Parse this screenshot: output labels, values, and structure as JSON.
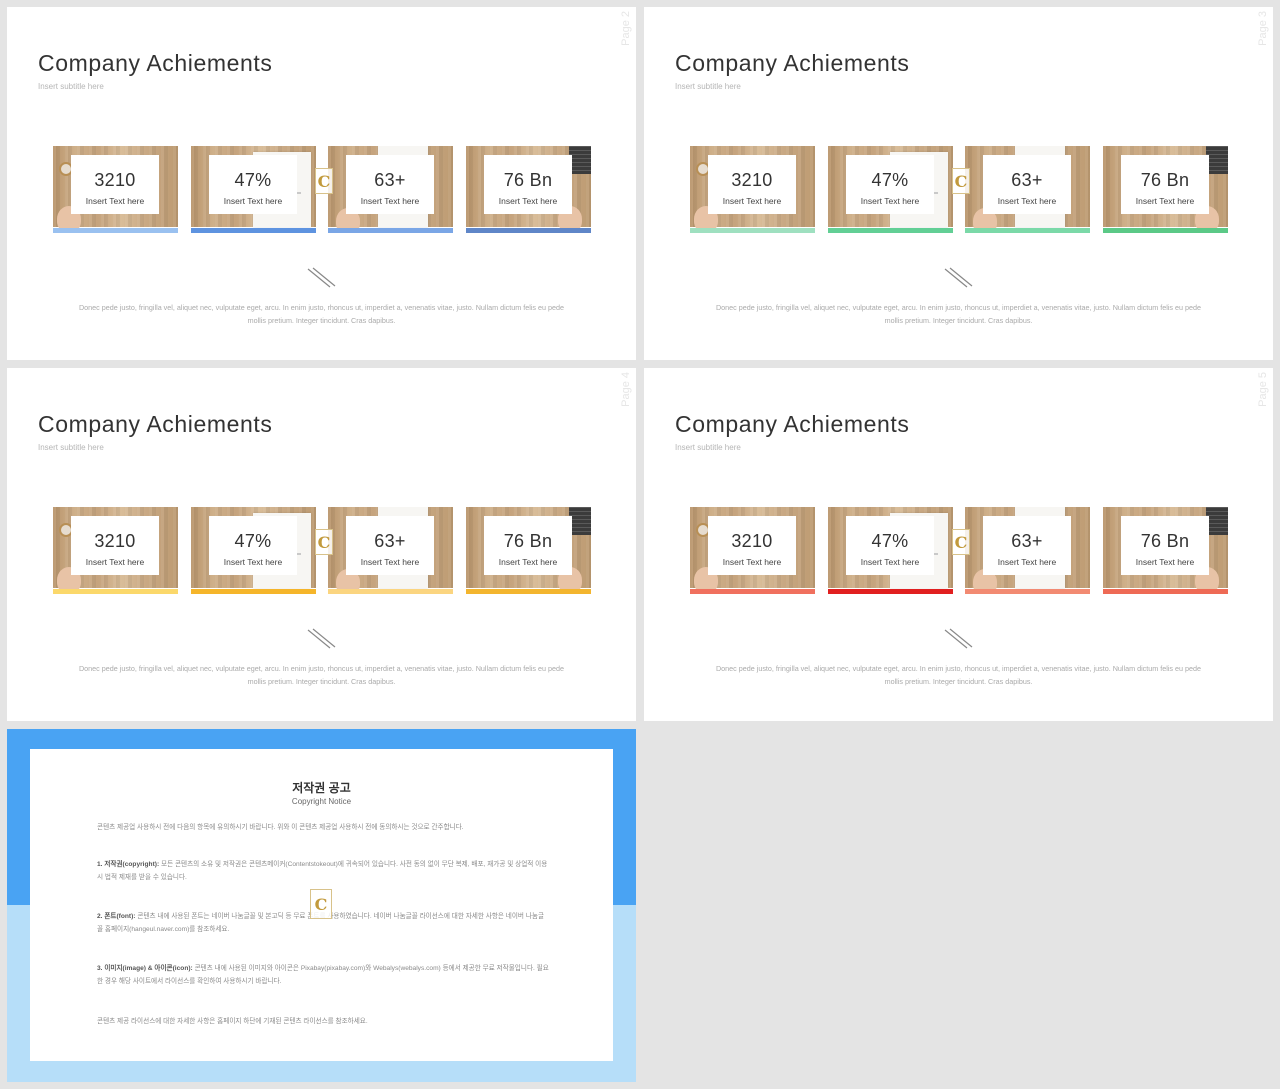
{
  "slides": [
    {
      "id": "s2",
      "title": "Company Achiements",
      "subtitle": "Insert subtitle here",
      "page_label": "Page 2",
      "bar_colors": [
        "#9ac1f0",
        "#5e93e0",
        "#7aa6e6",
        "#5f86c8"
      ],
      "cards": [
        {
          "value": "3210",
          "caption": "Insert Text here"
        },
        {
          "value": "47%",
          "caption": "Insert Text here"
        },
        {
          "value": "63+",
          "caption": "Insert Text here"
        },
        {
          "value": "76 Bn",
          "caption": "Insert Text here"
        }
      ],
      "body": "Donec pede justo, fringilla vel, aliquet nec, vulputate eget, arcu. In enim justo, rhoncus ut, imperdiet a, venenatis vitae, justo. Nullam dictum felis eu pede mollis pretium. Integer tincidunt. Cras dapibus."
    },
    {
      "id": "s3",
      "title": "Company Achiements",
      "subtitle": "Insert subtitle here",
      "page_label": "Page 3",
      "bar_colors": [
        "#9fe0c0",
        "#62cf95",
        "#7bd9a8",
        "#5bc987"
      ],
      "cards": [
        {
          "value": "3210",
          "caption": "Insert Text here"
        },
        {
          "value": "47%",
          "caption": "Insert Text here"
        },
        {
          "value": "63+",
          "caption": "Insert Text here"
        },
        {
          "value": "76 Bn",
          "caption": "Insert Text here"
        }
      ],
      "body": "Donec pede justo, fringilla vel, aliquet nec, vulputate eget, arcu. In enim justo, rhoncus ut, imperdiet a, venenatis vitae, justo. Nullam dictum felis eu pede mollis pretium. Integer tincidunt. Cras dapibus."
    },
    {
      "id": "s4",
      "title": "Company Achiements",
      "subtitle": "Insert subtitle here",
      "page_label": "Page 4",
      "bar_colors": [
        "#fbd86b",
        "#f5b52a",
        "#fbd580",
        "#f3b52e"
      ],
      "cards": [
        {
          "value": "3210",
          "caption": "Insert Text here"
        },
        {
          "value": "47%",
          "caption": "Insert Text here"
        },
        {
          "value": "63+",
          "caption": "Insert Text here"
        },
        {
          "value": "76 Bn",
          "caption": "Insert Text here"
        }
      ],
      "body": "Donec pede justo, fringilla vel, aliquet nec, vulputate eget, arcu. In enim justo, rhoncus ut, imperdiet a, venenatis vitae, justo. Nullam dictum felis eu pede mollis pretium. Integer tincidunt. Cras dapibus."
    },
    {
      "id": "s5",
      "title": "Company Achiements",
      "subtitle": "Insert subtitle here",
      "page_label": "Page 5",
      "bar_colors": [
        "#f0705e",
        "#e11f1f",
        "#f28a72",
        "#ee6a55"
      ],
      "cards": [
        {
          "value": "3210",
          "caption": "Insert Text here"
        },
        {
          "value": "47%",
          "caption": "Insert Text here"
        },
        {
          "value": "63+",
          "caption": "Insert Text here"
        },
        {
          "value": "76 Bn",
          "caption": "Insert Text here"
        }
      ],
      "body": "Donec pede justo, fringilla vel, aliquet nec, vulputate eget, arcu. In enim justo, rhoncus ut, imperdiet a, venenatis vitae, justo. Nullam dictum felis eu pede mollis pretium. Integer tincidunt. Cras dapibus."
    }
  ],
  "copyright": {
    "title": "저작권 공고",
    "subtitle": "Copyright Notice",
    "intro": "콘텐츠 제공업 사용하시 전에 다음의 항목에 유의하시기 바랍니다. 위와 이 콘텐츠 제공업 사용하시 전에 동의하시는 것으로 간주합니다.",
    "item1_head": "1. 저작권(copyright):",
    "item1_text": "모든 콘텐츠의 소유 및 저작권은 콘텐츠메이커(Contentstokeout)에 귀속되어 있습니다. 사전 동의 없이 무단 복제, 배포, 재가공 및 상업적 이용 시 법적 제재를 받을 수 있습니다.",
    "item2_head": "2. 폰트(font):",
    "item2_text": "콘텐츠 내에 사용된 폰트는 네이버 나눔글꼴 및 본고딕 등 무료 폰트를 사용하였습니다. 네이버 나눔글꼴 라이선스에 대한 자세한 사항은 네이버 나눔글꼴 홈페이지(hangeul.naver.com)를 참조하세요.",
    "item3_head": "3. 이미지(image) & 아이콘(icon):",
    "item3_text": "콘텐츠 내에 사용된 이미지와 아이콘은 Pixabay(pixabay.com)와 Webalys(webalys.com) 등에서 제공한 무료 저작물입니다. 필요한 경우 해당 사이트에서 라이선스를 확인하여 사용하시기 바랍니다.",
    "footer": "콘텐츠 제공 라이선스에 대한 자세한 사항은 홈페이지 하단에 기재된 콘텐츠 라이선스를 참조하세요."
  },
  "icons": {
    "logo_letter": "C"
  }
}
